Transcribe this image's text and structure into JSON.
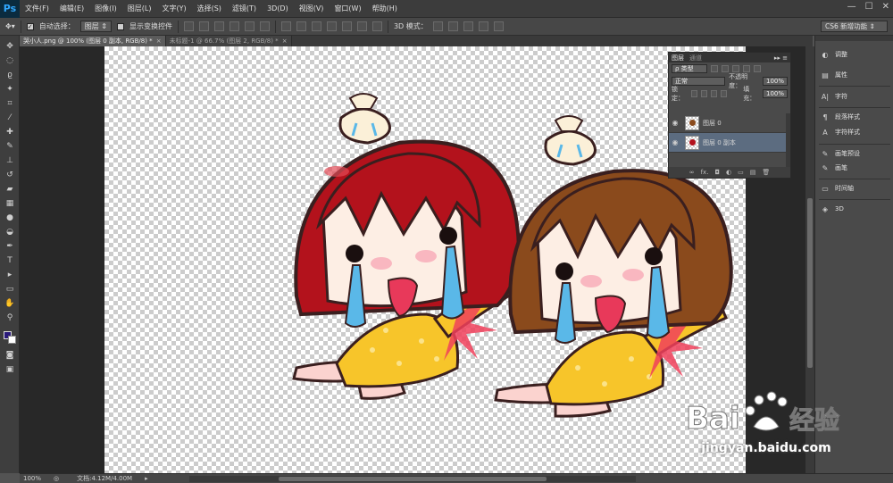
{
  "app": {
    "logo": "Ps"
  },
  "menu": [
    "文件(F)",
    "编辑(E)",
    "图像(I)",
    "图层(L)",
    "文字(Y)",
    "选择(S)",
    "滤镜(T)",
    "3D(D)",
    "视图(V)",
    "窗口(W)",
    "帮助(H)"
  ],
  "window_controls": {
    "minimize": "—",
    "maximize": "☐",
    "close": "✕"
  },
  "options": {
    "auto_select_label": "自动选择：",
    "auto_select_value": "图层",
    "show_transform_label": "显示变换控件",
    "mode_3d_label": "3D 模式：",
    "workspace": "CS6 新增功能"
  },
  "tabs": [
    {
      "label": "哭小人.png @ 100% (图层 0 副本, RGB/8) *",
      "close": "×"
    },
    {
      "label": "未标题-1 @ 66.7% (图层 2, RGB/8) *",
      "close": "×"
    }
  ],
  "layers_panel": {
    "tabs": [
      "图层",
      "通道"
    ],
    "collapse": "▸▸ ≡",
    "filter_label": "ρ 类型",
    "blend_mode": "正常",
    "opacity_label": "不透明度：",
    "opacity_value": "100%",
    "lock_label": "锁定：",
    "fill_label": "填充：",
    "fill_value": "100%",
    "layers": [
      {
        "name": "图层 0",
        "selected": false
      },
      {
        "name": "图层 0 副本",
        "selected": true
      }
    ],
    "footer_icons": [
      "∞",
      "fx.",
      "◘",
      "◐",
      "▭",
      "▤",
      "🗑"
    ]
  },
  "right_dock": [
    {
      "label": "调整",
      "icon": "◐"
    },
    {
      "label": "属性",
      "icon": "▤"
    },
    {
      "label": "字符",
      "icon": "A|"
    },
    {
      "label": "段落样式",
      "icon": "¶"
    },
    {
      "label": "字符样式",
      "icon": "A"
    },
    {
      "label": "画笔预设",
      "icon": "✎"
    },
    {
      "label": "画笔",
      "icon": "✎"
    },
    {
      "label": "时间轴",
      "icon": "▭"
    },
    {
      "label": "3D",
      "icon": "◈"
    }
  ],
  "status": {
    "zoom": "100%",
    "doc": "文档:4.12M/4.00M",
    "arrow": "▸"
  },
  "watermark": {
    "brand": "Bai 经验",
    "url": "jingyan.baidu.com"
  },
  "colors": {
    "foreground": "#2a1a7a",
    "background": "#ffffff",
    "hair_left": "#b3121c",
    "hair_right": "#8a4a1c",
    "dress": "#f7c52a"
  }
}
